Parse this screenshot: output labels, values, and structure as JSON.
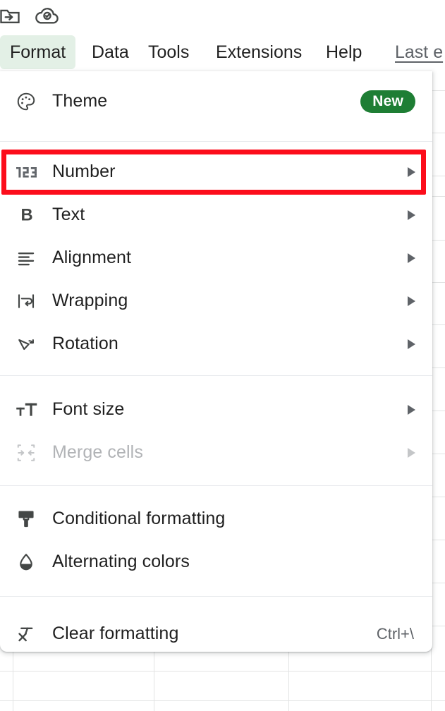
{
  "app": {
    "name": "Google Sheets",
    "toolbar_icons": [
      {
        "name": "move-to-folder-icon",
        "title": "Move"
      },
      {
        "name": "cloud-saved-icon",
        "title": "See document status"
      }
    ]
  },
  "menu_bar": {
    "items": [
      {
        "label": "Format",
        "active": true
      },
      {
        "label": "Data",
        "active": false
      },
      {
        "label": "Tools",
        "active": false
      },
      {
        "label": "Extensions",
        "active": false
      },
      {
        "label": "Help",
        "active": false
      }
    ],
    "last_edit": "Last e"
  },
  "format_menu": {
    "groups": [
      {
        "items": [
          {
            "label": "Theme",
            "icon": "palette-icon",
            "badge": "New",
            "arrow": false,
            "accel": "",
            "disabled": false
          }
        ]
      },
      {
        "items": [
          {
            "label": "Number",
            "icon": "number-123-icon",
            "badge": "",
            "arrow": true,
            "accel": "",
            "disabled": false,
            "highlighted": true
          },
          {
            "label": "Text",
            "icon": "bold-b-icon",
            "badge": "",
            "arrow": true,
            "accel": "",
            "disabled": false
          },
          {
            "label": "Alignment",
            "icon": "align-left-icon",
            "badge": "",
            "arrow": true,
            "accel": "",
            "disabled": false
          },
          {
            "label": "Wrapping",
            "icon": "text-wrap-icon",
            "badge": "",
            "arrow": true,
            "accel": "",
            "disabled": false
          },
          {
            "label": "Rotation",
            "icon": "text-rotation-icon",
            "badge": "",
            "arrow": true,
            "accel": "",
            "disabled": false
          }
        ]
      },
      {
        "items": [
          {
            "label": "Font size",
            "icon": "font-size-icon",
            "badge": "",
            "arrow": true,
            "accel": "",
            "disabled": false
          },
          {
            "label": "Merge cells",
            "icon": "merge-cells-icon",
            "badge": "",
            "arrow": true,
            "accel": "",
            "disabled": true
          }
        ]
      },
      {
        "items": [
          {
            "label": "Conditional formatting",
            "icon": "paint-roller-icon",
            "badge": "",
            "arrow": false,
            "accel": "",
            "disabled": false
          },
          {
            "label": "Alternating colors",
            "icon": "droplet-half-icon",
            "badge": "",
            "arrow": false,
            "accel": "",
            "disabled": false
          }
        ]
      },
      {
        "items": [
          {
            "label": "Clear formatting",
            "icon": "clear-formatting-icon",
            "badge": "",
            "arrow": false,
            "accel": "Ctrl+\\",
            "disabled": false
          }
        ]
      }
    ]
  },
  "colors": {
    "menu_active_bg": "#e3f0e6",
    "badge_green": "#1e7e34",
    "highlight_red": "#fc0d1b",
    "icon_gray": "#444746",
    "text_primary": "#1f1f1f",
    "text_secondary": "#5f6368",
    "grid_line": "#e2e3e3",
    "separator": "#e8eaed"
  }
}
